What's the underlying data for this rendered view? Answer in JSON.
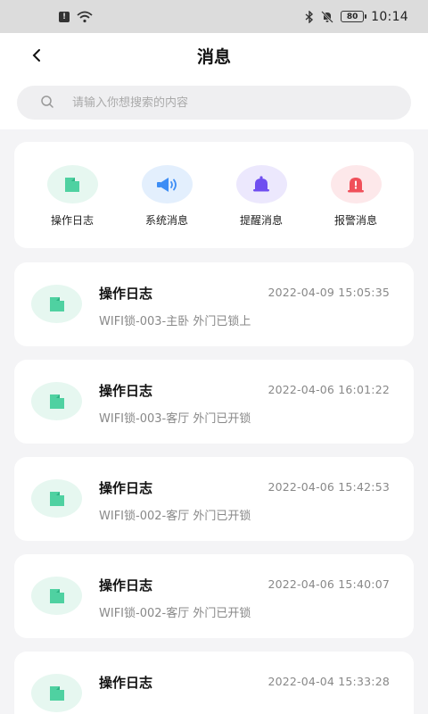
{
  "status_bar": {
    "time": "10:14",
    "battery": "80",
    "sim_alert": "!"
  },
  "header": {
    "title": "消息",
    "search": {
      "placeholder": "请输入你想搜索的内容",
      "value": ""
    }
  },
  "categories": [
    {
      "label": "操作日志",
      "icon": "folder-icon",
      "color": "#4fd1a1",
      "bg": "#e6f7f0"
    },
    {
      "label": "系统消息",
      "icon": "speaker-icon",
      "color": "#3d8df5",
      "bg": "#e3effd"
    },
    {
      "label": "提醒消息",
      "icon": "bell-icon",
      "color": "#6f4ef0",
      "bg": "#ece8fd"
    },
    {
      "label": "报警消息",
      "icon": "alarm-icon",
      "color": "#f0505a",
      "bg": "#fde8ea"
    }
  ],
  "messages": [
    {
      "title": "操作日志",
      "time": "2022-04-09 15:05:35",
      "desc": "WIFI锁-003-主卧 外门已锁上"
    },
    {
      "title": "操作日志",
      "time": "2022-04-06 16:01:22",
      "desc": "WIFI锁-003-客厅 外门已开锁"
    },
    {
      "title": "操作日志",
      "time": "2022-04-06 15:42:53",
      "desc": "WIFI锁-002-客厅 外门已开锁"
    },
    {
      "title": "操作日志",
      "time": "2022-04-06 15:40:07",
      "desc": "WIFI锁-002-客厅 外门已开锁"
    },
    {
      "title": "操作日志",
      "time": "2022-04-04 15:33:28",
      "desc": ""
    }
  ]
}
